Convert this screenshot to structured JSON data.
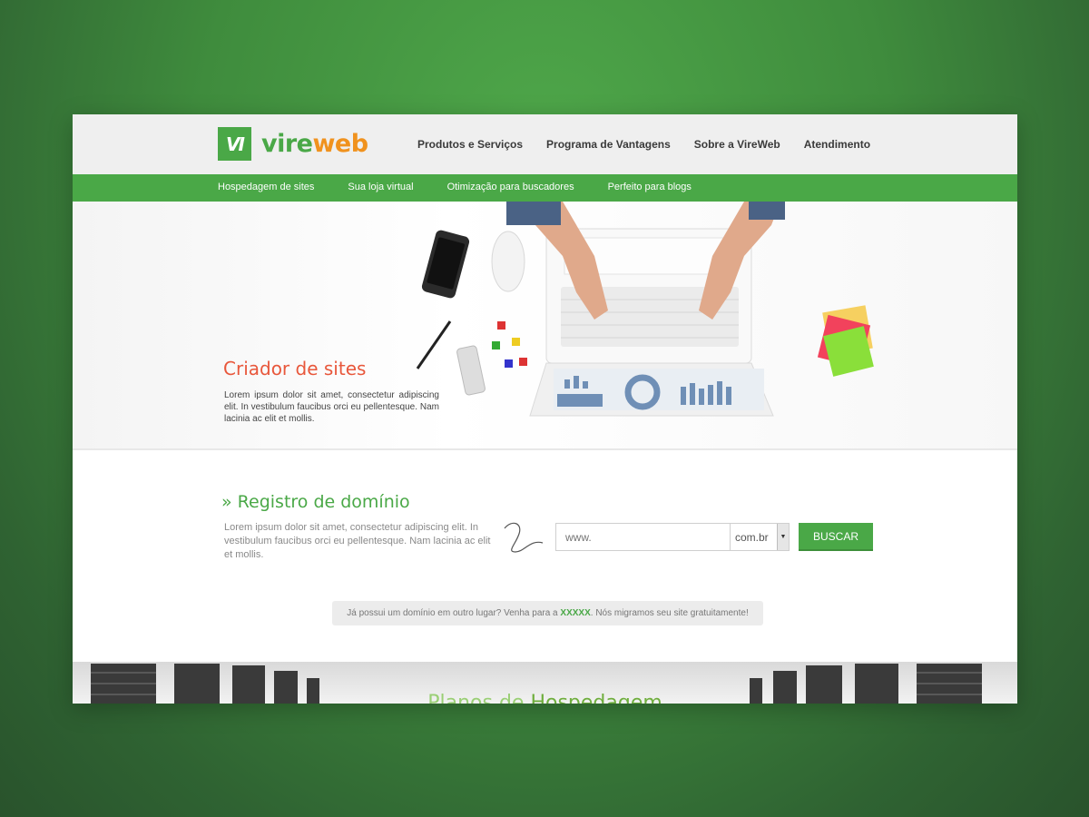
{
  "brand": {
    "logo_mark": "VI",
    "name_part1": "vire",
    "name_part2": "web"
  },
  "topnav": [
    "Produtos e Serviços",
    "Programa de Vantagens",
    "Sobre a VireWeb",
    "Atendimento"
  ],
  "subnav": [
    "Hospedagem de sites",
    "Sua loja virtual",
    "Otimização para buscadores",
    "Perfeito para blogs"
  ],
  "hero": {
    "title": "Criador de sites",
    "text": "Lorem ipsum dolor sit amet, consectetur adipiscing elit. In vestibulum faucibus orci eu pellentesque. Nam lacinia ac elit et mollis."
  },
  "domain": {
    "title": "» Registro de domínio",
    "text": "Lorem ipsum dolor sit amet, consectetur adipiscing elit. In vestibulum faucibus orci eu pellentesque. Nam lacinia ac elit et mollis.",
    "input_placeholder": "www.",
    "tld_selected": "com.br",
    "search_button": "BUSCAR"
  },
  "notice": {
    "before": "Já possui um domínio em outro lugar? Venha para a ",
    "link": "XXXXX",
    "after": ". Nós migramos seu site gratuitamente!"
  },
  "plans": {
    "title_part1": "Planos de ",
    "title_part2": "Hospedagem"
  },
  "colors": {
    "brand_green": "#4aa847",
    "brand_orange": "#f0921e",
    "accent_red": "#e8573b"
  }
}
